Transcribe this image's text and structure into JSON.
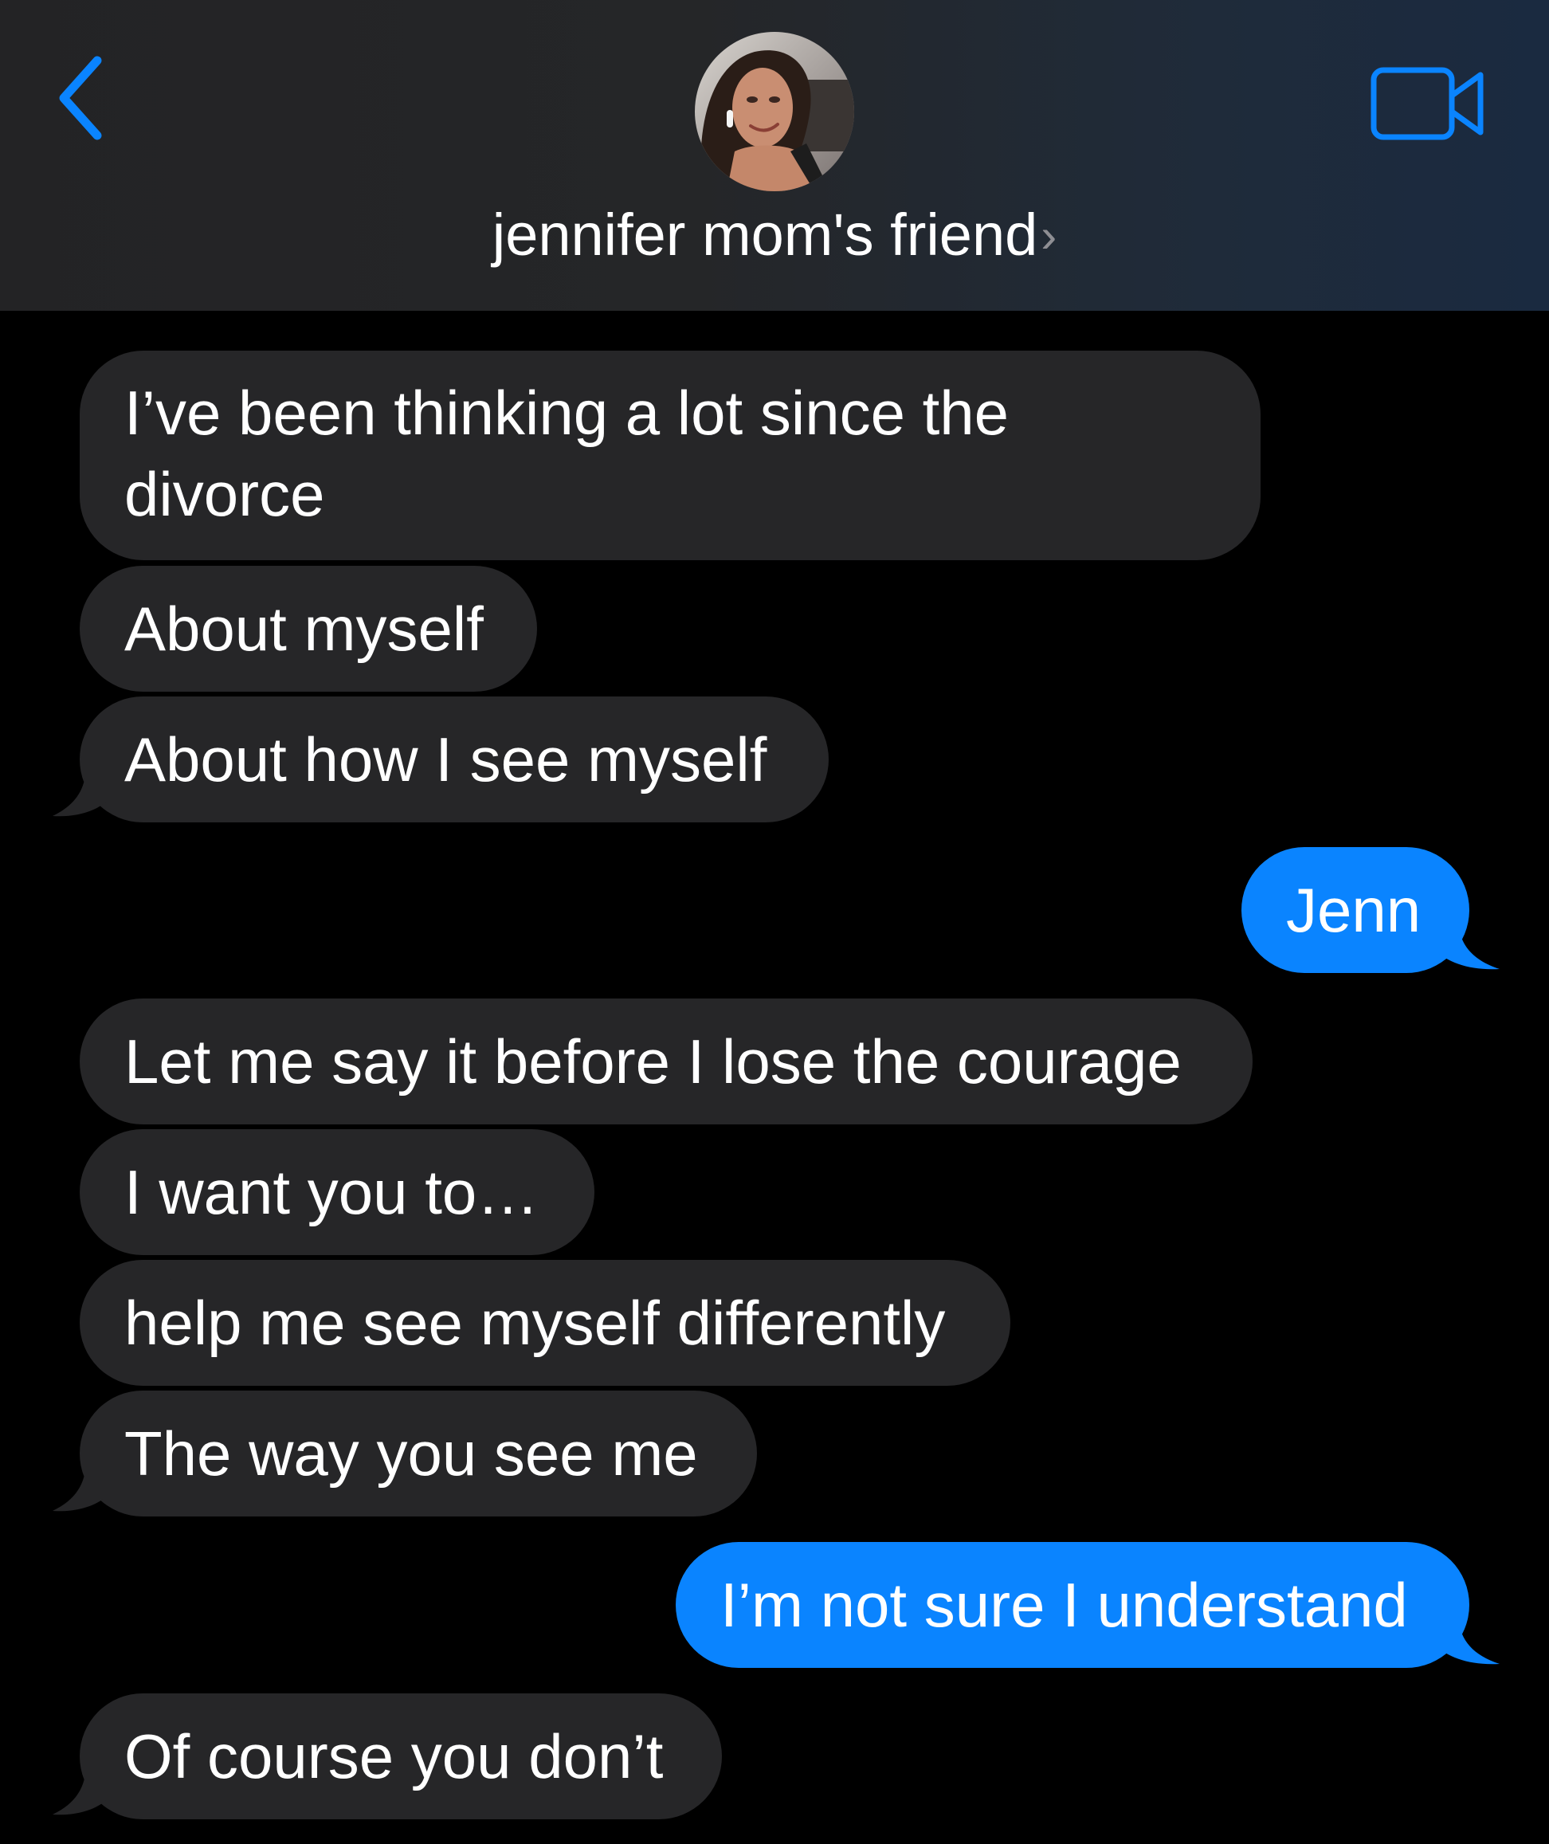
{
  "header": {
    "contact_name": "jennifer mom's friend",
    "chevron": "›",
    "back_icon": "chevron-left-icon",
    "video_icon": "video-camera-icon",
    "accent_color": "#0a84ff"
  },
  "messages": [
    {
      "direction": "incoming",
      "text": "I’ve been thinking a lot since the divorce"
    },
    {
      "direction": "incoming",
      "text": "About myself"
    },
    {
      "direction": "incoming",
      "text": "About how I see myself"
    },
    {
      "direction": "outgoing",
      "text": "Jenn"
    },
    {
      "direction": "incoming",
      "text": "Let me say it before I lose the courage"
    },
    {
      "direction": "incoming",
      "text": "I want you to…"
    },
    {
      "direction": "incoming",
      "text": "help me see myself differently"
    },
    {
      "direction": "incoming",
      "text": "The way you see me"
    },
    {
      "direction": "outgoing",
      "text": "I’m not sure I understand"
    },
    {
      "direction": "incoming",
      "text": "Of course you don’t"
    }
  ],
  "colors": {
    "incoming_bubble": "#262628",
    "outgoing_bubble": "#0a84ff",
    "background": "#000000"
  }
}
